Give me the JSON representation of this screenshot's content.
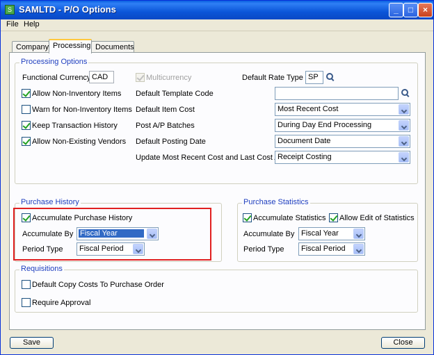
{
  "window": {
    "title": "SAMLTD - P/O Options"
  },
  "menu": {
    "file": "File",
    "help": "Help"
  },
  "tabs": [
    {
      "label": "Company"
    },
    {
      "label": "Processing",
      "active": true
    },
    {
      "label": "Documents"
    }
  ],
  "processing_options": {
    "title": "Processing Options",
    "functional_currency_label": "Functional Currency",
    "functional_currency_value": "CAD",
    "multicurrency_label": "Multicurrency",
    "default_rate_type_label": "Default Rate Type",
    "default_rate_type_value": "SP",
    "allow_non_inventory_label": "Allow Non-Inventory Items",
    "warn_non_inventory_label": "Warn for Non-Inventory Items",
    "keep_transaction_history_label": "Keep Transaction History",
    "allow_non_existing_vendors_label": "Allow Non-Existing Vendors",
    "default_template_code_label": "Default Template Code",
    "default_template_code_value": "",
    "default_item_cost_label": "Default Item Cost",
    "default_item_cost_value": "Most Recent Cost",
    "post_ap_batches_label": "Post A/P Batches",
    "post_ap_batches_value": "During Day End Processing",
    "default_posting_date_label": "Default Posting Date",
    "default_posting_date_value": "Document Date",
    "update_recent_cost_label": "Update Most Recent Cost and Last Cost At",
    "update_recent_cost_value": "Receipt Costing"
  },
  "purchase_history": {
    "title": "Purchase History",
    "accumulate_label": "Accumulate Purchase History",
    "accumulate_by_label": "Accumulate By",
    "accumulate_by_value": "Fiscal Year",
    "period_type_label": "Period Type",
    "period_type_value": "Fiscal Period"
  },
  "purchase_statistics": {
    "title": "Purchase Statistics",
    "accumulate_label": "Accumulate Statistics",
    "allow_edit_label": "Allow Edit of Statistics",
    "accumulate_by_label": "Accumulate By",
    "accumulate_by_value": "Fiscal Year",
    "period_type_label": "Period Type",
    "period_type_value": "Fiscal Period"
  },
  "requisitions": {
    "title": "Requisitions",
    "copy_costs_label": "Default Copy Costs To Purchase Order",
    "require_approval_label": "Require Approval"
  },
  "buttons": {
    "save": "Save",
    "close": "Close"
  },
  "colors": {
    "highlight_border": "#e02020",
    "group_title": "#1f3fbf"
  }
}
